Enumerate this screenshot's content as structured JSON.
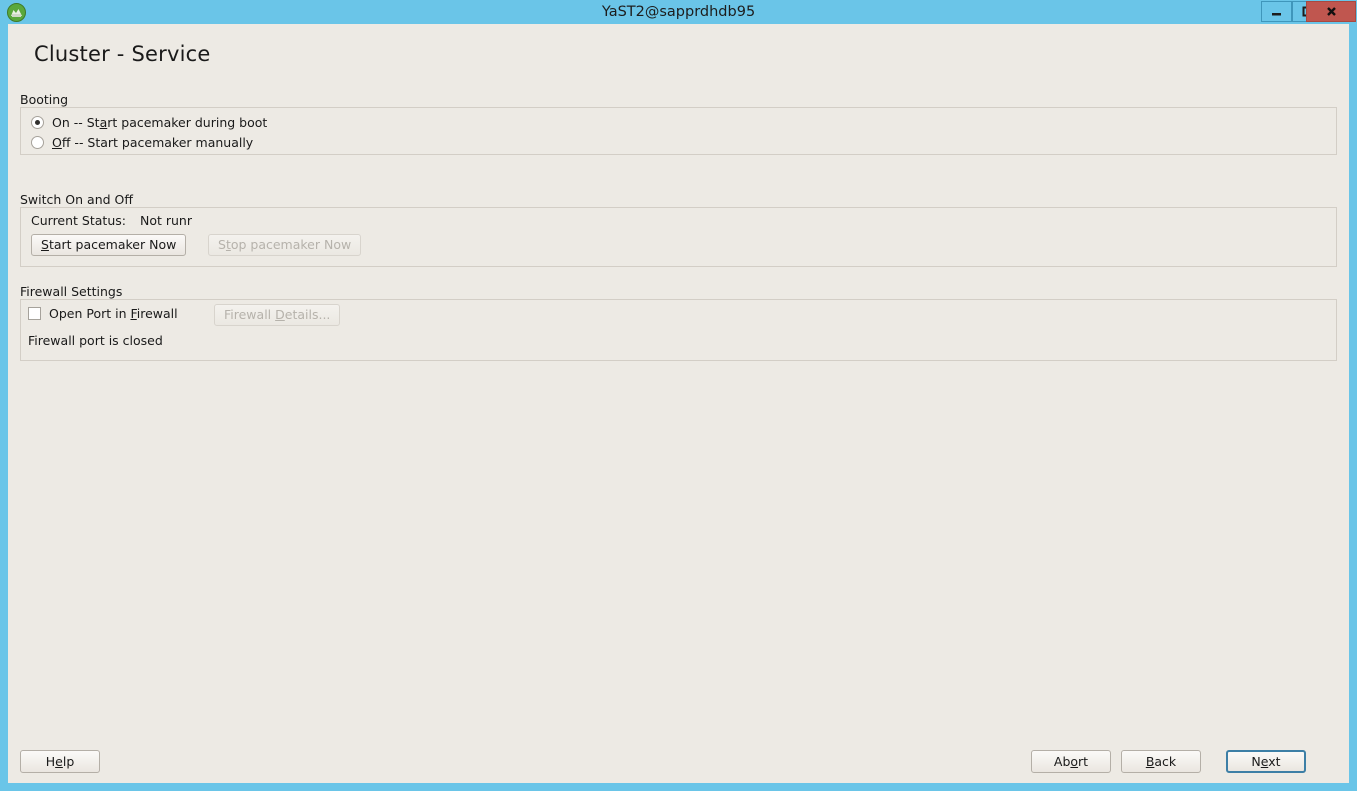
{
  "window": {
    "title": "YaST2@sapprdhdb95",
    "icon": "yast-globe-icon",
    "controls": {
      "minimize": "minimize-icon",
      "maximize": "maximize-icon",
      "close": "close-icon"
    },
    "colors": {
      "titlebar": "#6ac5e8",
      "client_background": "#edeae4",
      "close_button": "#c0564f",
      "default_button_border": "#3d7fa6"
    }
  },
  "page": {
    "title": "Cluster - Service"
  },
  "booting": {
    "group_label": "Booting",
    "options": [
      {
        "id": "on",
        "label_before": "On -- St",
        "accelerator": "a",
        "label_after": "rt pacemaker during boot",
        "selected": true
      },
      {
        "id": "off",
        "label_before": "",
        "accelerator": "O",
        "label_after": "ff -- Start pacemaker manually",
        "selected": false
      }
    ]
  },
  "switch_on_off": {
    "group_label": "Switch On and Off",
    "status_label": "Current Status:",
    "status_value": "Not runr",
    "start_button": {
      "label_before": "",
      "accelerator": "S",
      "label_after": "tart pacemaker Now",
      "enabled": true
    },
    "stop_button": {
      "label_before": "S",
      "accelerator": "t",
      "label_after": "op pacemaker Now",
      "enabled": false
    }
  },
  "firewall": {
    "group_label": "Firewall Settings",
    "checkbox": {
      "label_before": "Open Port in ",
      "accelerator": "F",
      "label_after": "irewall",
      "checked": false
    },
    "details_button": {
      "label_before": "Firewall ",
      "accelerator": "D",
      "label_after": "etails...",
      "enabled": false
    },
    "status_text": "Firewall port is closed"
  },
  "footer": {
    "help": {
      "label_before": "H",
      "accelerator": "e",
      "label_after": "lp"
    },
    "abort": {
      "label_before": "Ab",
      "accelerator": "o",
      "label_after": "rt"
    },
    "back": {
      "label_before": "",
      "accelerator": "B",
      "label_after": "ack"
    },
    "next": {
      "label_before": "N",
      "accelerator": "e",
      "label_after": "xt",
      "is_default": true
    }
  }
}
